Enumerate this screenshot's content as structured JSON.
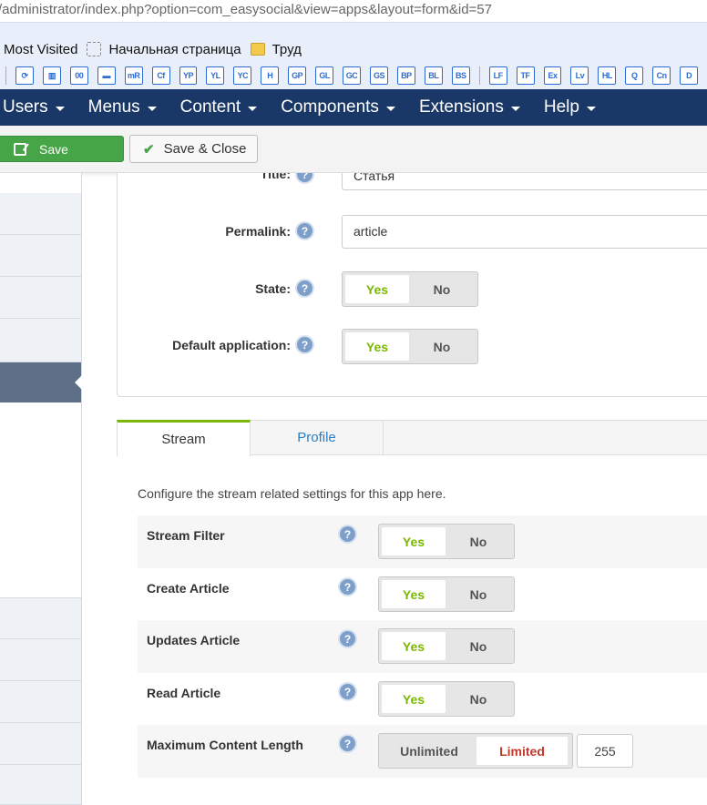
{
  "browser": {
    "url": "/administrator/index.php?option=com_easysocial&view=apps&layout=form&id=57",
    "bookmarks": [
      {
        "label": "Most Visited",
        "icon": "none"
      },
      {
        "label": "Начальная страница",
        "icon": "dashed-page-icon"
      },
      {
        "label": "Труд",
        "icon": "folder-icon"
      }
    ],
    "toolbar_icons": [
      "⟳",
      "▥",
      "00",
      "▬",
      "mR",
      "Cf",
      "YP",
      "YL",
      "YC",
      "H",
      "GP",
      "GL",
      "GC",
      "GS",
      "BP",
      "BL",
      "BS",
      "LF",
      "TF",
      "Ex",
      "Lv",
      "HL",
      "Q",
      "Cn",
      "D"
    ]
  },
  "nav": {
    "items": [
      "Users",
      "Menus",
      "Content",
      "Components",
      "Extensions",
      "Help"
    ]
  },
  "actions": {
    "save_label": "Save",
    "save_close_label": "Save & Close"
  },
  "form": {
    "title_label": "Title:",
    "title_value": "Статья",
    "permalink_label": "Permalink:",
    "permalink_value": "article",
    "state_label": "State:",
    "default_app_label": "Default application:",
    "yes": "Yes",
    "no": "No"
  },
  "tabs": {
    "stream": "Stream",
    "profile": "Profile"
  },
  "stream": {
    "description": "Configure the stream related settings for this app here.",
    "rows": [
      {
        "label": "Stream Filter",
        "value": "Yes"
      },
      {
        "label": "Create Article",
        "value": "Yes"
      },
      {
        "label": "Updates Article",
        "value": "Yes"
      },
      {
        "label": "Read Article",
        "value": "Yes"
      }
    ],
    "max_length_label": "Maximum Content Length",
    "unlimited": "Unlimited",
    "limited": "Limited",
    "max_length_value": "255"
  },
  "colors": {
    "nav_bg": "#1a3867",
    "save_green": "#46a546",
    "yes_green": "#7ab800",
    "limited_red": "#c0392b",
    "tab_link": "#2a7ec5"
  }
}
